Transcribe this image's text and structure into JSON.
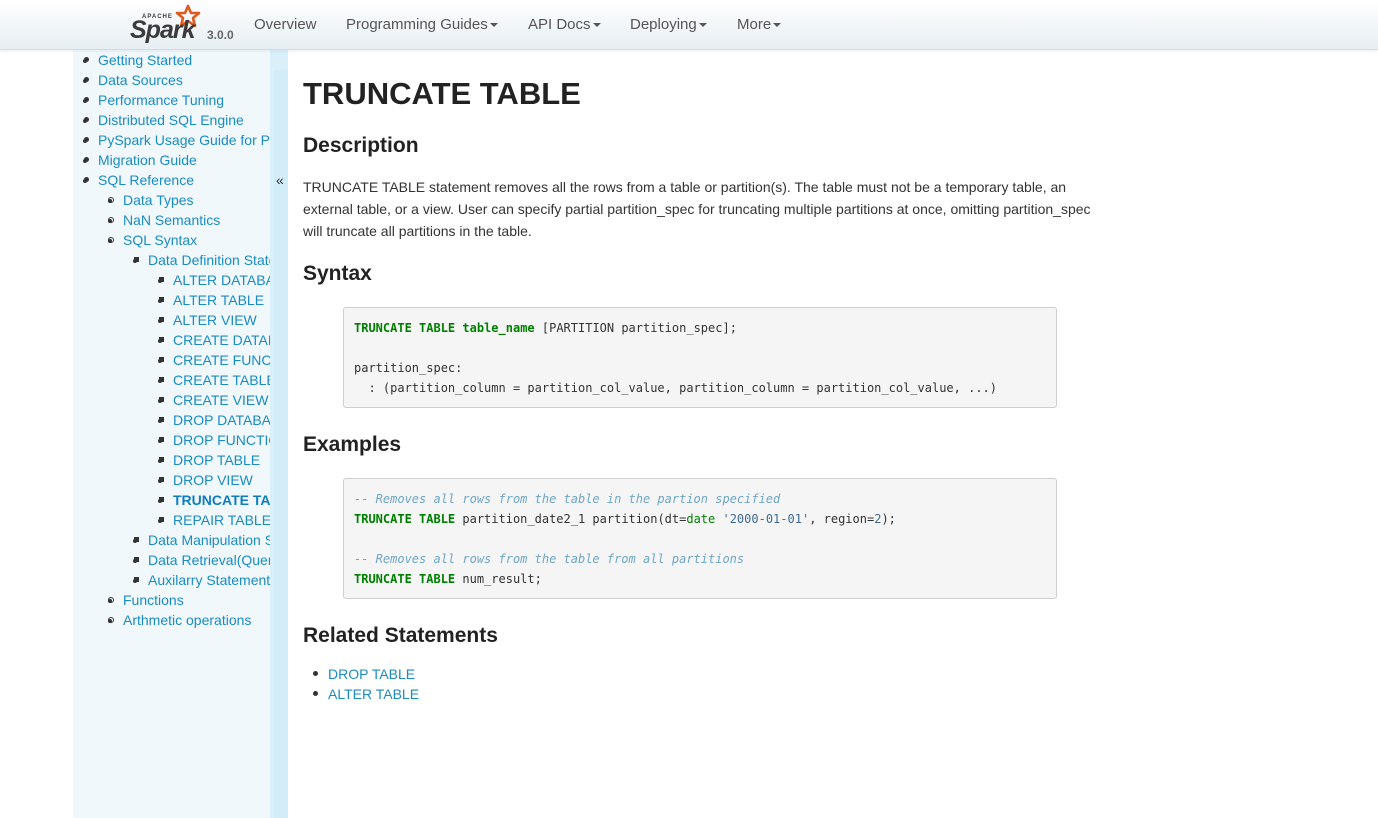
{
  "brand": {
    "apache": "APACHE",
    "name": "Spark",
    "tm": "™",
    "version": "3.0.0",
    "accent_color": "#e25a1c"
  },
  "nav": {
    "overview": "Overview",
    "programming_guides": "Programming Guides",
    "api_docs": "API Docs",
    "deploying": "Deploying",
    "more": "More"
  },
  "sidebar": {
    "collapse_label": "«",
    "items": [
      {
        "label": "Getting Started"
      },
      {
        "label": "Data Sources"
      },
      {
        "label": "Performance Tuning"
      },
      {
        "label": "Distributed SQL Engine"
      },
      {
        "label": "PySpark Usage Guide for Pandas with Apache Arrow"
      },
      {
        "label": "Migration Guide"
      },
      {
        "label": "SQL Reference"
      },
      {
        "label": "Data Types"
      },
      {
        "label": "NaN Semantics"
      },
      {
        "label": "SQL Syntax"
      },
      {
        "label": "Data Definition Statements"
      },
      {
        "label": "ALTER DATABASE"
      },
      {
        "label": "ALTER TABLE"
      },
      {
        "label": "ALTER VIEW"
      },
      {
        "label": "CREATE DATABASE"
      },
      {
        "label": "CREATE FUNCTION"
      },
      {
        "label": "CREATE TABLE"
      },
      {
        "label": "CREATE VIEW"
      },
      {
        "label": "DROP DATABASE"
      },
      {
        "label": "DROP FUNCTION"
      },
      {
        "label": "DROP TABLE"
      },
      {
        "label": "DROP VIEW"
      },
      {
        "label": "TRUNCATE TABLE"
      },
      {
        "label": "REPAIR TABLE"
      },
      {
        "label": "Data Manipulation Statements"
      },
      {
        "label": "Data Retrieval(Queries)"
      },
      {
        "label": "Auxilarry Statements"
      },
      {
        "label": "Functions"
      },
      {
        "label": "Arthmetic operations"
      }
    ]
  },
  "main": {
    "title": "TRUNCATE TABLE",
    "description_heading": "Description",
    "description": "TRUNCATE TABLE statement removes all the rows from a table or partition(s). The table must not be a temporary table, an external table, or a view. User can specify partial partition_spec for truncating multiple partitions at once, omitting partition_spec will truncate all partitions in the table.",
    "syntax_heading": "Syntax",
    "syntax": {
      "kw1": "TRUNCATE",
      "kw2": "TABLE",
      "ident": "table_name",
      "rest1": " [PARTITION partition_spec];",
      "line3": "partition_spec:",
      "line4": "  : (partition_column = partition_col_value, partition_column = partition_col_value, ...)"
    },
    "examples_heading": "Examples",
    "examples": {
      "comment1": "-- Removes all rows from the table in the partion specified",
      "kw1": "TRUNCATE",
      "kw2": "TABLE",
      "line2_a": " partition_date2_1 partition(dt=",
      "line2_type": "date",
      "line2_space": " ",
      "line2_str": "'2000-01-01'",
      "line2_b": ", region=",
      "line2_num": "2",
      "line2_c": ");",
      "comment2": "-- Removes all rows from the table from all partitions",
      "kw3": "TRUNCATE",
      "kw4": "TABLE",
      "line5_rest": " num_result;"
    },
    "related_heading": "Related Statements",
    "related": [
      {
        "label": "DROP TABLE"
      },
      {
        "label": "ALTER TABLE"
      }
    ]
  }
}
